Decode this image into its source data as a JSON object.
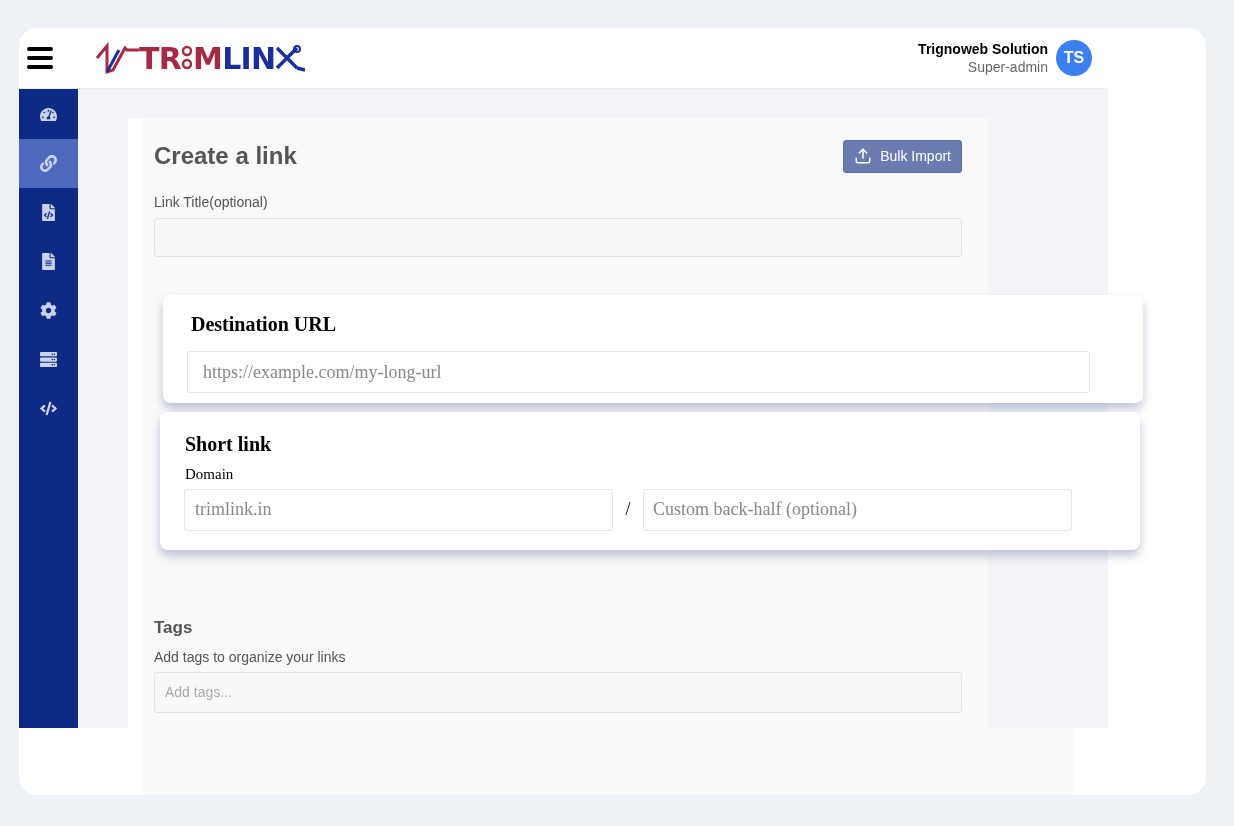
{
  "header": {
    "logo_left": "TR",
    "logo_mid": "M",
    "logo_right": "LIN",
    "user_name": "Trignoweb Solution",
    "user_role": "Super-admin",
    "avatar": "TS"
  },
  "sidebar": {
    "items": [
      {
        "kind": "gauge",
        "selected": false
      },
      {
        "kind": "link",
        "selected": true
      },
      {
        "kind": "code-file",
        "selected": false
      },
      {
        "kind": "file",
        "selected": false
      },
      {
        "kind": "gear",
        "selected": false
      },
      {
        "kind": "server",
        "selected": false
      },
      {
        "kind": "code",
        "selected": false
      }
    ]
  },
  "form": {
    "title": "Create a link",
    "bulk_button": "Bulk Import",
    "link_title_label": "Link Title(optional)",
    "tags_heading": "Tags",
    "tags_hint": "Add tags to organize your links",
    "tags_placeholder": "Add tags..."
  },
  "destination_card": {
    "title": "Destination URL",
    "placeholder": "https://example.com/my-long-url"
  },
  "short_link_card": {
    "title": "Short link",
    "domain_label": "Domain",
    "domain_placeholder": "trimlink.in",
    "separator": "/",
    "back_half_placeholder": "Custom back-half (optional)"
  }
}
